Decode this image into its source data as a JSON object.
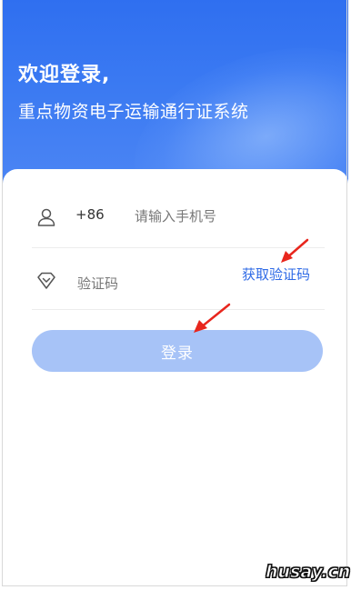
{
  "header": {
    "title": "欢迎登录,",
    "subtitle": "重点物资电子运输通行证系统"
  },
  "form": {
    "phone": {
      "prefix": "+86",
      "placeholder": "请输入手机号",
      "value": ""
    },
    "code": {
      "placeholder": "验证码",
      "value": "",
      "get_code_label": "获取验证码"
    },
    "login_label": "登录"
  },
  "watermark": "husay.cn",
  "colors": {
    "brand": "#2f6ff0",
    "link": "#2e6ae6",
    "button_disabled": "#a7c3f7",
    "arrow": "#e8261d"
  },
  "icons": {
    "phone_row": "user-icon",
    "code_row": "diamond-shield-icon"
  }
}
